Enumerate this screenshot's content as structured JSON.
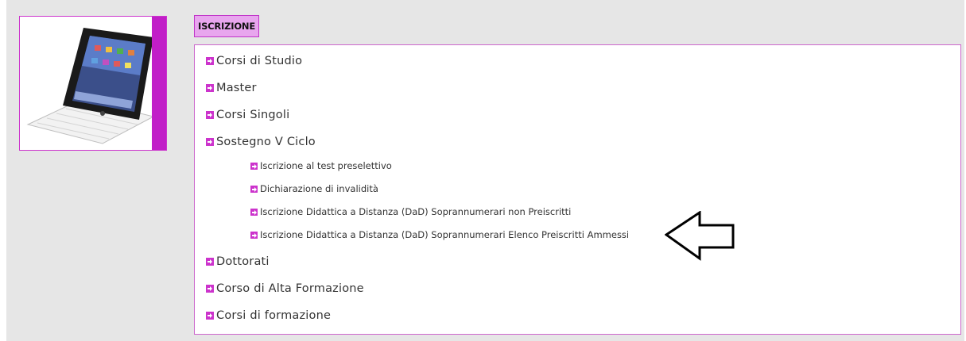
{
  "header": {
    "tab_label": "ISCRIZIONE"
  },
  "menu": {
    "items": [
      {
        "label": "Corsi di Studio"
      },
      {
        "label": "Master"
      },
      {
        "label": "Corsi Singoli"
      },
      {
        "label": "Sostegno V Ciclo"
      },
      {
        "label": "Iscrizione al test preselettivo"
      },
      {
        "label": "Dichiarazione di invalidità"
      },
      {
        "label": "Iscrizione Didattica a Distanza (DaD) Soprannumerari non Preiscritti"
      },
      {
        "label": "Iscrizione Didattica a Distanza (DaD) Soprannumerari Elenco Preiscritti Ammessi"
      },
      {
        "label": "Dottorati"
      },
      {
        "label": "Corso di Alta Formazione"
      },
      {
        "label": "Corsi di formazione"
      }
    ]
  },
  "icons": {
    "bullet": "arrow-right-square-icon",
    "pointer": "left-arrow-outline-icon",
    "image": "tablet-keyboard-image"
  },
  "colors": {
    "accent": "#c11ec8",
    "tab_background": "#e8a6ee",
    "panel_background": "#e6e6e6"
  }
}
